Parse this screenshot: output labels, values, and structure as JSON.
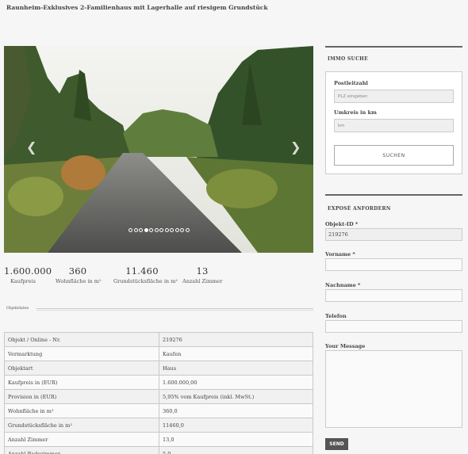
{
  "page": {
    "title": "Raunheim-Exklusives 2-Familienhaus mit Lagerhalle auf riesigem Grundstück"
  },
  "gallery": {
    "dot_count": 12,
    "active_dot": 3,
    "prev_icon": "❮",
    "next_icon": "❯"
  },
  "stats": [
    {
      "value": "1.600.000",
      "label": "Kaufpreis"
    },
    {
      "value": "360",
      "label": "Wohnfläche in m²"
    },
    {
      "value": "11.460",
      "label": "Grundstücksfläche in m²"
    },
    {
      "value": "13",
      "label": "Anzahl Zimmer"
    }
  ],
  "details": {
    "section_label": "Objektdaten",
    "rows": [
      {
        "label": "Objekt / Online - Nr.",
        "value": "219276"
      },
      {
        "label": "Vermarktung",
        "value": "Kaufen"
      },
      {
        "label": "Objektart",
        "value": "Haus"
      },
      {
        "label": "Kaufpreis in (EUR)",
        "value": "1.600.000,00"
      },
      {
        "label": "Provision in (EUR)",
        "value": "5,95% vom Kaufpreis (inkl. MwSt.)"
      },
      {
        "label": "Wohnfläche in m²",
        "value": "360,0"
      },
      {
        "label": "Grundstücksfläche in m²",
        "value": "11460,0"
      },
      {
        "label": "Anzahl Zimmer",
        "value": "13,0"
      },
      {
        "label": "Anzahl Badezimmer",
        "value": "5,0"
      }
    ]
  },
  "search": {
    "heading": "IMMO SUCHE",
    "plz_label": "Postleitzahl",
    "plz_placeholder": "PLZ eingeben",
    "radius_label": "Umkreis in km",
    "radius_placeholder": "km",
    "button": "SUCHEN"
  },
  "expose": {
    "heading": "EXPOSÈ ANFORDERN",
    "objekt_id_label": "Objekt-ID *",
    "objekt_id_value": "219276",
    "vorname_label": "Vorname *",
    "nachname_label": "Nachname *",
    "telefon_label": "Telefon",
    "message_label": "Your Message",
    "send_button": "SEND"
  }
}
